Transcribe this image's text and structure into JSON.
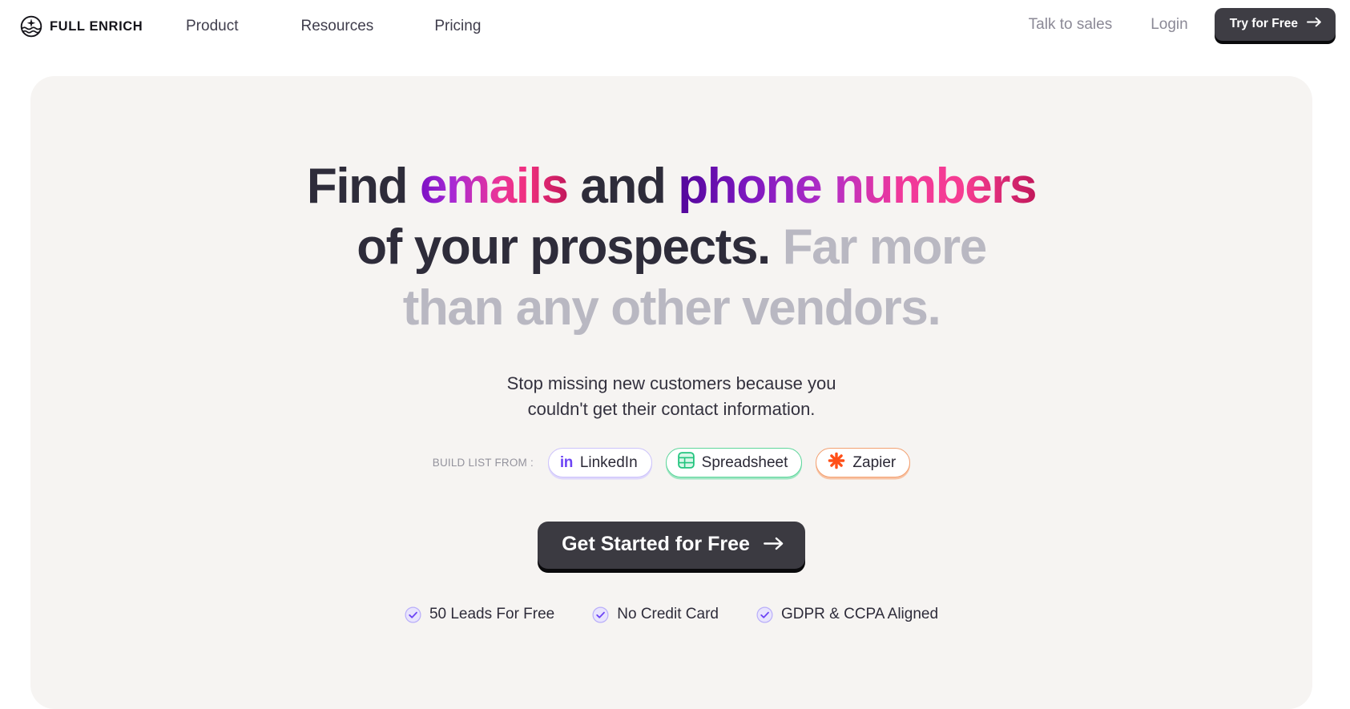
{
  "brand": {
    "name": "FULL ENRICH",
    "logo_icon": "sunrise-wave-circle-icon"
  },
  "nav": {
    "links": [
      {
        "label": "Product"
      },
      {
        "label": "Resources"
      },
      {
        "label": "Pricing"
      }
    ],
    "talk_to_sales": "Talk to sales",
    "login": "Login",
    "try_button": "Try for Free",
    "try_button_icon": "arrow-right-icon"
  },
  "hero": {
    "headline": {
      "line1_part1": "Find ",
      "line1_grad1": "emails",
      "line1_part2": " and ",
      "line1_grad2": "phone numbers",
      "line2_dark": "of your prospects. ",
      "line2_muted": "Far more",
      "line3_muted": "than any other vendors."
    },
    "subhead_line1": "Stop missing new customers because you",
    "subhead_line2": "couldn't get their contact information.",
    "build_label": "BUILD LIST FROM :",
    "sources": [
      {
        "label": "LinkedIn",
        "icon": "linkedin-icon",
        "color": "#6d45f5"
      },
      {
        "label": "Spreadsheet",
        "icon": "spreadsheet-icon",
        "color": "#22c47e"
      },
      {
        "label": "Zapier",
        "icon": "zapier-icon",
        "color": "#ff4f18"
      }
    ],
    "cta_label": "Get Started for Free",
    "cta_icon": "arrow-right-icon",
    "perks": [
      {
        "label": "50 Leads For Free"
      },
      {
        "label": "No Credit Card"
      },
      {
        "label": "GDPR & CCPA Aligned"
      }
    ]
  },
  "colors": {
    "page_bg": "#ffffff",
    "hero_bg": "#f6f4f2",
    "text_dark": "#2e2c3a",
    "text_muted": "#b9b8c2",
    "button_dark": "#3b3a41",
    "accent_purple": "#6d45f5",
    "accent_green": "#22c47e",
    "accent_orange": "#ff4f18"
  }
}
